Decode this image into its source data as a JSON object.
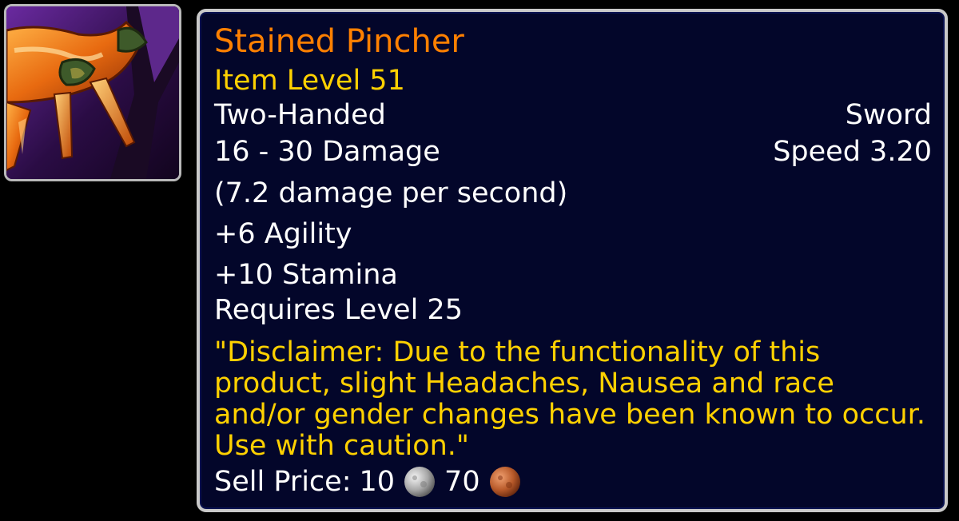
{
  "item": {
    "icon": "crab-claw-sword-icon",
    "name": "Stained Pincher",
    "item_level": "Item Level 51",
    "slot": "Two-Handed",
    "type": "Sword",
    "damage": "16 - 30 Damage",
    "speed": "Speed 3.20",
    "dps": "(7.2 damage per second)",
    "stats": [
      "+6 Agility",
      "+10 Stamina"
    ],
    "requirement": "Requires Level 25",
    "flavor_text": "\"Disclaimer: Due to the functionality of this product, slight Headaches, Nausea and race and/or gender changes have been known to occur. Use with caution.\"",
    "sell_price": {
      "label": "Sell Price:",
      "silver": "10",
      "copper": "70"
    }
  },
  "colors": {
    "rarity_name": "#ff8000",
    "gold_text": "#ffd100",
    "text": "#ffffff",
    "tooltip_bg": "#03062a",
    "border": "#c9c9c9"
  }
}
